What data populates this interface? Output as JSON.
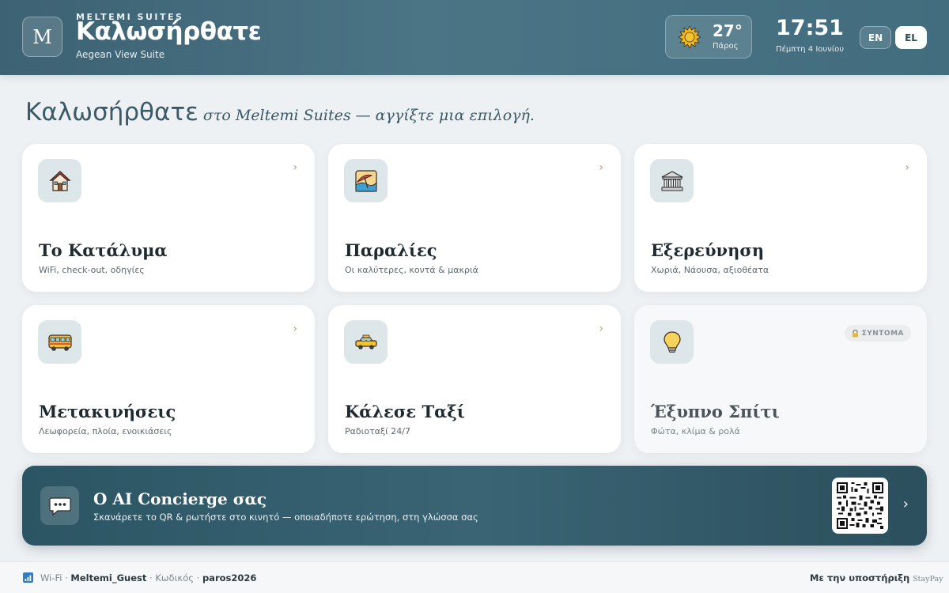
{
  "header": {
    "logo_letter": "M",
    "brand_small": "MELTEMI SUITES",
    "brand_title": "Καλωσήρθατε",
    "brand_sub": "Aegean View Suite",
    "weather": {
      "icon": "sun-icon",
      "temp": "27°",
      "place": "Πάρος"
    },
    "clock": "17:51",
    "date": "Πέμπτη 4 Ιουνίου",
    "languages": [
      {
        "code": "EN",
        "active": false
      },
      {
        "code": "EL",
        "active": true
      }
    ]
  },
  "headline": {
    "big": "Καλωσήρθατε",
    "italic": "στο Meltemi Suites — αγγίξτε μια επιλογή."
  },
  "cards": [
    {
      "icon": "house-icon",
      "title": "Το Κατάλυμα",
      "subtitle": "WiFi, check-out, οδηγίες",
      "chevron": "›"
    },
    {
      "icon": "beach-icon",
      "title": "Παραλίες",
      "subtitle": "Οι καλύτερες, κοντά & μακριά",
      "chevron": "›"
    },
    {
      "icon": "museum-icon",
      "title": "Εξερεύνηση",
      "subtitle": "Χωριά, Νάουσα, αξιοθέατα",
      "chevron": "›"
    },
    {
      "icon": "bus-icon",
      "title": "Μετακινήσεις",
      "subtitle": "Λεωφορεία, πλοία, ενοικιάσεις",
      "chevron": "›"
    },
    {
      "icon": "taxi-icon",
      "title": "Κάλεσε Ταξί",
      "subtitle": "Ραδιοταξί 24/7",
      "chevron": "›"
    },
    {
      "icon": "lightbulb-icon",
      "title": "Έξυπνο Σπίτι",
      "subtitle": "Φώτα, κλίμα & ρολά",
      "badge": "ΣΥΝΤΟΜΑ"
    }
  ],
  "concierge": {
    "title": "Ο AI Concierge σας",
    "subtitle": "Σκανάρετε το QR & ρωτήστε στο κινητό — οποιαδήποτε ερώτηση, στη γλώσσα σας",
    "chevron": "›"
  },
  "footer": {
    "wifi_label": "Wi-Fi",
    "network": "Meltemi_Guest",
    "password_label": "Κωδικός",
    "password": "paros2026",
    "support_text": "Με την υποστήριξη",
    "support_brand": "StayPay"
  },
  "colors": {
    "header": "#426d7e",
    "accent_chevron": "#b89c6e",
    "concierge": "#2c5564",
    "background": "#eef1f3"
  }
}
